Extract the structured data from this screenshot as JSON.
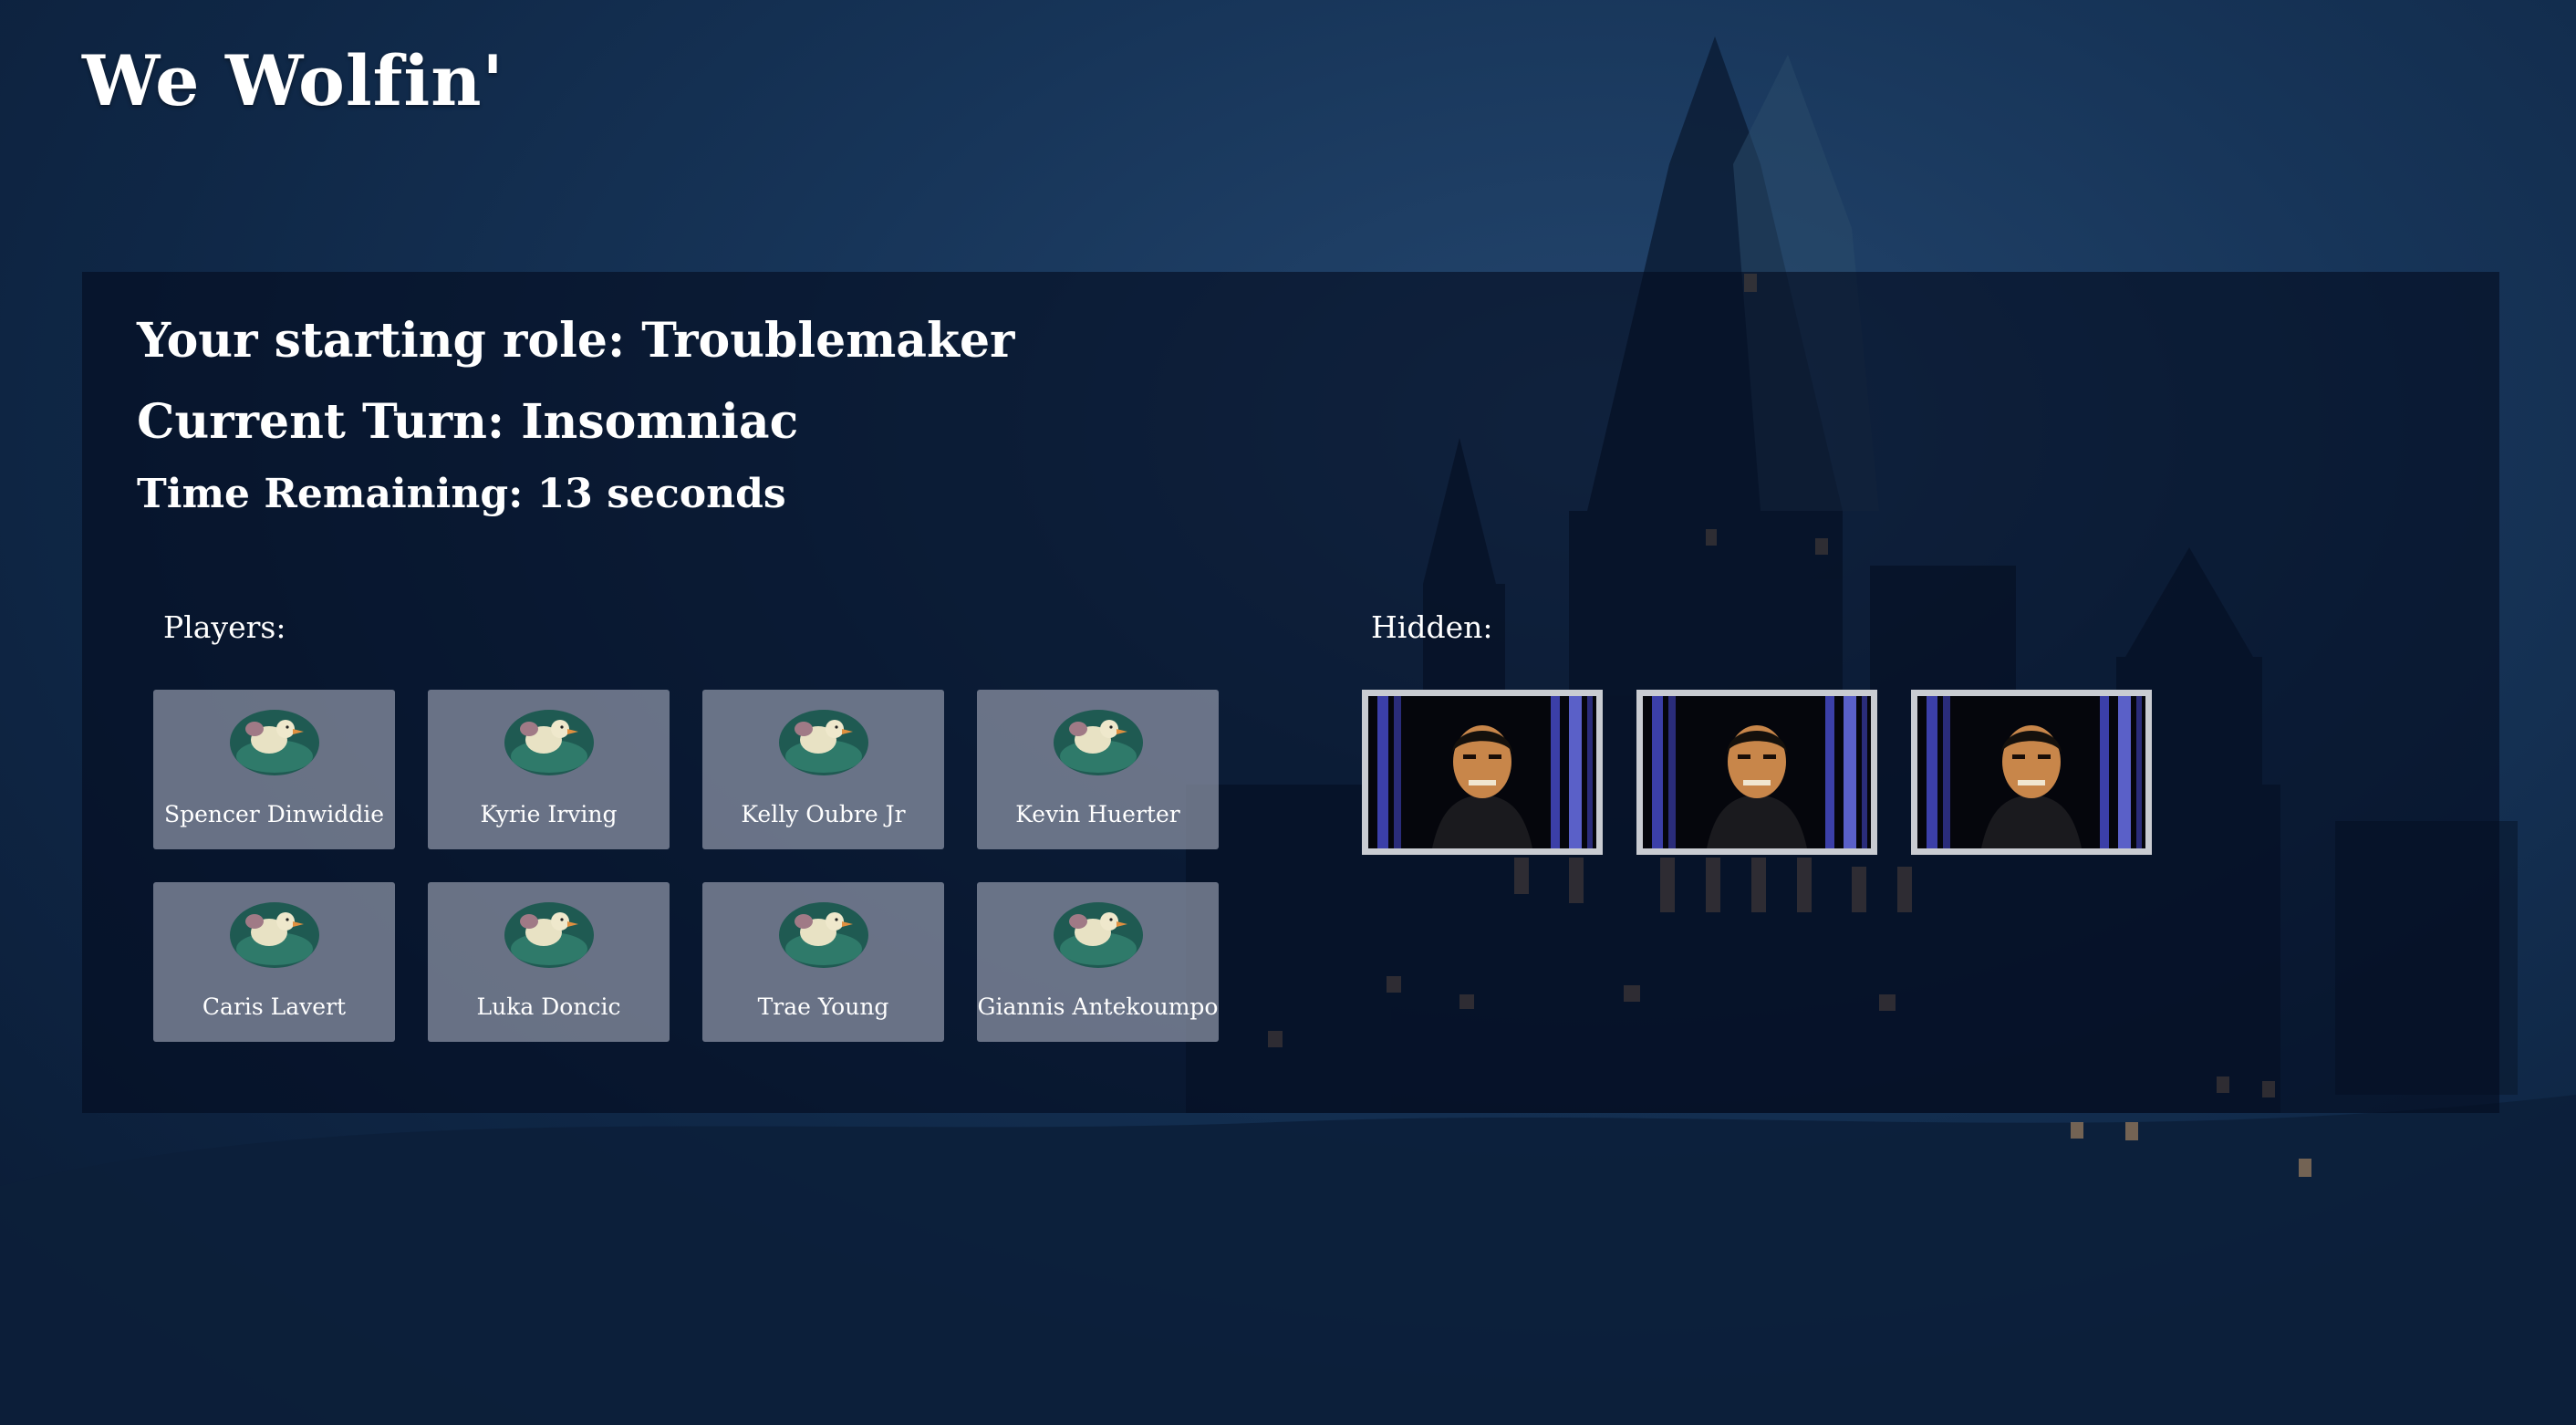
{
  "app": {
    "title": "We Wolfin'"
  },
  "game": {
    "starting_role_text": "Your starting role: Troublemaker",
    "current_turn_text": "Current Turn: Insomniac",
    "time_remaining_text": "Time Remaining: 13 seconds"
  },
  "players": {
    "label": "Players:",
    "items": [
      {
        "name": "Spencer Dinwiddie",
        "icon": "duck-avatar-icon"
      },
      {
        "name": "Kyrie Irving",
        "icon": "duck-avatar-icon"
      },
      {
        "name": "Kelly Oubre Jr",
        "icon": "duck-avatar-icon"
      },
      {
        "name": "Kevin Huerter",
        "icon": "duck-avatar-icon"
      },
      {
        "name": "Caris Lavert",
        "icon": "duck-avatar-icon"
      },
      {
        "name": "Luka Doncic",
        "icon": "duck-avatar-icon"
      },
      {
        "name": "Trae Young",
        "icon": "duck-avatar-icon"
      },
      {
        "name": "Giannis Antekoumpo",
        "icon": "duck-avatar-icon"
      }
    ]
  },
  "hidden": {
    "label": "Hidden:",
    "cards": [
      {
        "icon": "werewolf-card-icon"
      },
      {
        "icon": "werewolf-card-icon"
      },
      {
        "icon": "werewolf-card-icon"
      }
    ]
  },
  "colors": {
    "panel": "#040c1e",
    "card_bg": "#8f96a8",
    "hidden_border": "#c9ccd2",
    "background": "#173559"
  }
}
